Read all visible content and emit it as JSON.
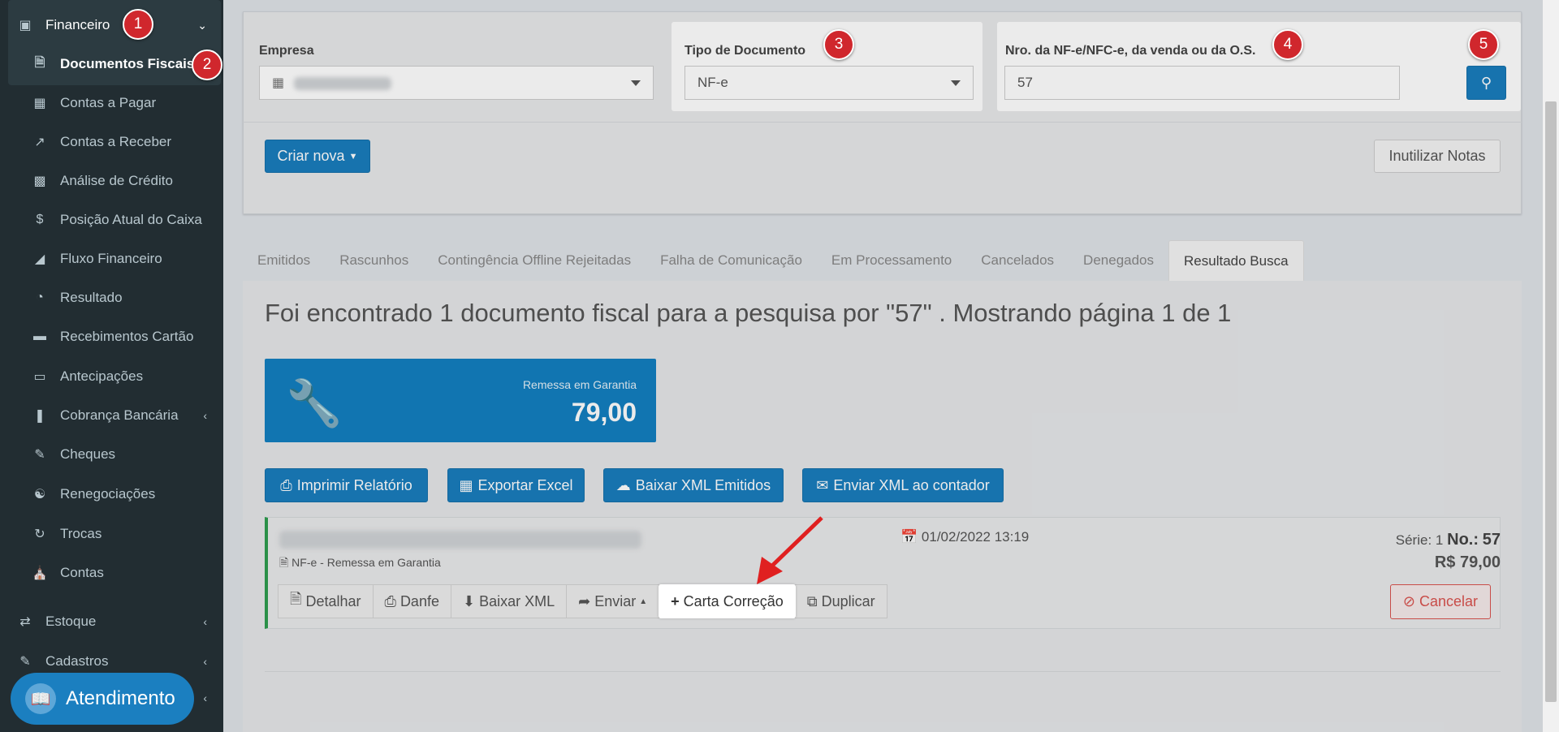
{
  "sidebar": {
    "top_item": {
      "label": "Financeiro",
      "icon": "money-icon"
    },
    "items": [
      {
        "label": "Documentos Fiscais",
        "icon": "file-icon"
      },
      {
        "label": "Contas a Pagar",
        "icon": "calculator-icon"
      },
      {
        "label": "Contas a Receber",
        "icon": "line-chart-icon"
      },
      {
        "label": "Análise de Crédito",
        "icon": "id-card-icon"
      },
      {
        "label": "Posição Atual do Caixa",
        "icon": "dollar-icon"
      },
      {
        "label": "Fluxo Financeiro",
        "icon": "area-chart-icon"
      },
      {
        "label": "Resultado",
        "icon": "pie-chart-icon"
      },
      {
        "label": "Recebimentos Cartão",
        "icon": "credit-card-icon"
      },
      {
        "label": "Antecipações",
        "icon": "card-icon"
      },
      {
        "label": "Cobrança Bancária",
        "icon": "barcode-icon"
      },
      {
        "label": "Cheques",
        "icon": "edit-icon"
      },
      {
        "label": "Renegociações",
        "icon": "handshake-icon"
      },
      {
        "label": "Trocas",
        "icon": "refresh-icon"
      },
      {
        "label": "Contas",
        "icon": "bank-icon"
      }
    ],
    "other": [
      {
        "label": "Estoque",
        "icon": "exchange-icon"
      },
      {
        "label": "Cadastros",
        "icon": "edit-icon"
      }
    ],
    "support_label": "Atendimento"
  },
  "badges": [
    "1",
    "2",
    "3",
    "4",
    "5"
  ],
  "filters": {
    "empresa_label": "Empresa",
    "tipo_label": "Tipo de Documento",
    "tipo_value": "NF-e",
    "numero_label": "Nro. da NF-e/NFC-e, da venda ou da O.S.",
    "numero_value": "57"
  },
  "actions": {
    "criar_nova": "Criar nova",
    "inutilizar": "Inutilizar Notas"
  },
  "tabs": [
    "Emitidos",
    "Rascunhos",
    "Contingência Offline Rejeitadas",
    "Falha de Comunicação",
    "Em Processamento",
    "Cancelados",
    "Denegados",
    "Resultado Busca"
  ],
  "result": {
    "title": "Foi encontrado 1 documento fiscal para a pesquisa por \"57\" . Mostrando página 1 de 1",
    "tile_label": "Remessa em Garantia",
    "tile_value": "79,00"
  },
  "report_buttons": {
    "imprimir": "Imprimir Relatório",
    "exportar": "Exportar Excel",
    "baixar": "Baixar XML Emitidos",
    "enviar": "Enviar XML ao contador"
  },
  "document": {
    "type": "NF-e - Remessa em Garantia",
    "date": "01/02/2022 13:19",
    "serie_label": "Série:",
    "serie_value": "1",
    "no_label": "No.:",
    "no_value": "57",
    "amount": "R$ 79,00"
  },
  "doc_buttons": {
    "detalhar": "Detalhar",
    "danfe": "Danfe",
    "baixar_xml": "Baixar XML",
    "enviar": "Enviar",
    "carta": "Carta Correção",
    "duplicar": "Duplicar",
    "cancelar": "Cancelar"
  }
}
